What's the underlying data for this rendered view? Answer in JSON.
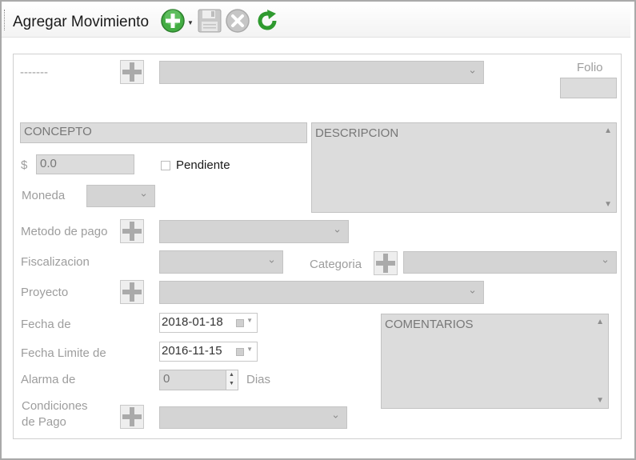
{
  "toolbar": {
    "title": "Agregar Movimiento",
    "buttons": [
      {
        "name": "add",
        "icon": "plus-circle-icon",
        "color": "#3aa33a"
      },
      {
        "name": "save",
        "icon": "floppy-disk-icon",
        "color": "#bdbdbd"
      },
      {
        "name": "cancel",
        "icon": "x-circle-icon",
        "color": "#c4c4c4"
      },
      {
        "name": "refresh",
        "icon": "refresh-icon",
        "color": "#2f9a2f"
      }
    ]
  },
  "form": {
    "selector_placeholder": "-------",
    "folio_label": "Folio",
    "folio_value": "",
    "concepto_placeholder": "CONCEPTO",
    "descripcion_placeholder": "DESCRIPCION",
    "currency_symbol": "$",
    "amount_value": "0.0",
    "pendiente_label": "Pendiente",
    "pendiente_checked": false,
    "moneda_label": "Moneda",
    "metodo_pago_label": "Metodo de pago",
    "fiscalizacion_label": "Fiscalizacion",
    "categoria_label": "Categoria",
    "proyecto_label": "Proyecto",
    "fecha_label": "Fecha de",
    "fecha_value": "2018-01-18",
    "fecha_limite_label": "Fecha Limite de",
    "fecha_limite_value": "2016-11-15",
    "alarma_label": "Alarma de",
    "alarma_value": "0",
    "dias_label": "Dias",
    "condiciones_label_1": "Condiciones",
    "condiciones_label_2": "de Pago",
    "comentarios_placeholder": "COMENTARIOS"
  }
}
